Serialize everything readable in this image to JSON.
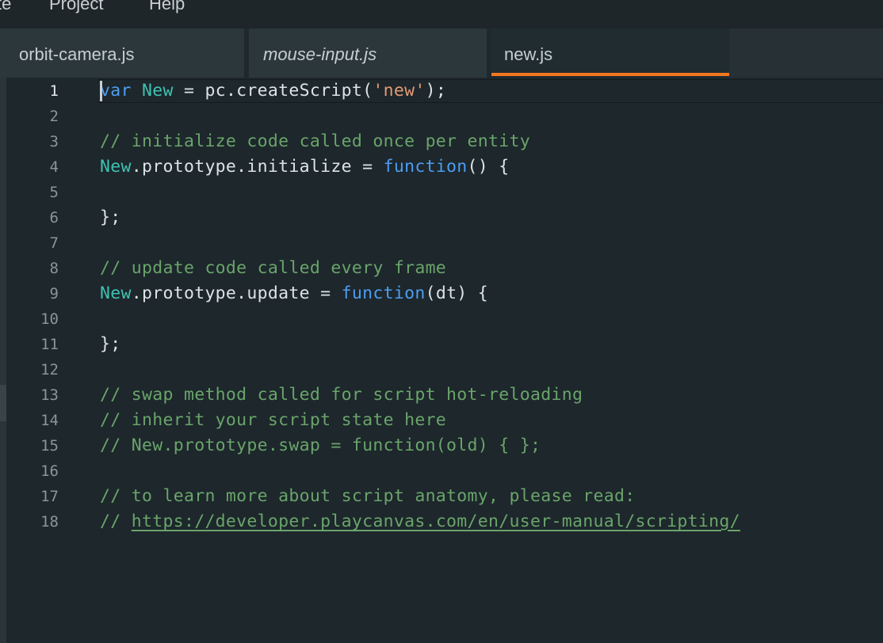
{
  "menubar": {
    "items": [
      {
        "label": "te"
      },
      {
        "label": "Project"
      },
      {
        "label": "Help"
      }
    ]
  },
  "tabs": [
    {
      "label": "orbit-camera.js",
      "italic": false,
      "active": false
    },
    {
      "label": "mouse-input.js",
      "italic": true,
      "active": false
    },
    {
      "label": "new.js",
      "italic": false,
      "active": true
    }
  ],
  "colors": {
    "accent": "#f4771f",
    "background": "#1d272c",
    "keyword": "#4d9df0",
    "class": "#3fc1b0",
    "string": "#e59a72",
    "comment": "#6aa46a"
  },
  "editor": {
    "current_line": 1,
    "line_numbers": [
      "1",
      "2",
      "3",
      "4",
      "5",
      "6",
      "7",
      "8",
      "9",
      "10",
      "11",
      "12",
      "13",
      "14",
      "15",
      "16",
      "17",
      "18"
    ],
    "lines": {
      "l1": {
        "kw": "var",
        "cls": "New",
        "rest1": " = pc.createScript(",
        "str": "'new'",
        "rest2": ");"
      },
      "l3": {
        "comment": "// initialize code called once per entity"
      },
      "l4": {
        "cls": "New",
        "rest1": ".prototype.initialize = ",
        "kw": "function",
        "rest2": "() {"
      },
      "l6": {
        "text": "};"
      },
      "l8": {
        "comment": "// update code called every frame"
      },
      "l9": {
        "cls": "New",
        "rest1": ".prototype.update = ",
        "kw": "function",
        "rest2": "(dt) {"
      },
      "l11": {
        "text": "};"
      },
      "l13": {
        "comment": "// swap method called for script hot-reloading"
      },
      "l14": {
        "comment": "// inherit your script state here"
      },
      "l15": {
        "comment": "// New.prototype.swap = function(old) { };"
      },
      "l17": {
        "comment": "// to learn more about script anatomy, please read:"
      },
      "l18": {
        "prefix": "// ",
        "link": "https://developer.playcanvas.com/en/user-manual/scripting/"
      }
    }
  }
}
